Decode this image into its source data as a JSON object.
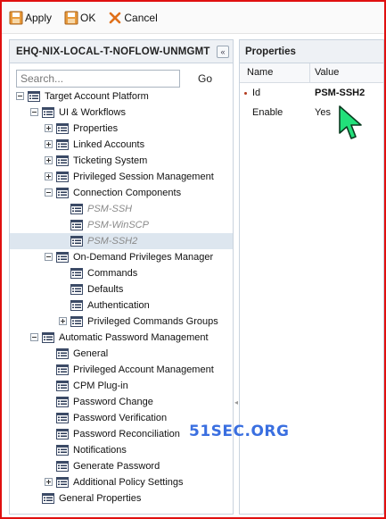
{
  "toolbar": {
    "apply_label": "Apply",
    "ok_label": "OK",
    "cancel_label": "Cancel"
  },
  "left_panel": {
    "title": "EHQ-NIX-LOCAL-T-NOFLOW-UNMGMT",
    "search_placeholder": "Search...",
    "go_label": "Go"
  },
  "tree": [
    {
      "label": "Target Account Platform",
      "level": 0,
      "ctrl": "minus",
      "greyed": false,
      "selected": false
    },
    {
      "label": "UI & Workflows",
      "level": 1,
      "ctrl": "minus",
      "greyed": false,
      "selected": false
    },
    {
      "label": "Properties",
      "level": 2,
      "ctrl": "plus",
      "greyed": false,
      "selected": false
    },
    {
      "label": "Linked Accounts",
      "level": 2,
      "ctrl": "plus",
      "greyed": false,
      "selected": false
    },
    {
      "label": "Ticketing System",
      "level": 2,
      "ctrl": "plus",
      "greyed": false,
      "selected": false
    },
    {
      "label": "Privileged Session Management",
      "level": 2,
      "ctrl": "plus",
      "greyed": false,
      "selected": false
    },
    {
      "label": "Connection Components",
      "level": 2,
      "ctrl": "minus",
      "greyed": false,
      "selected": false
    },
    {
      "label": "PSM-SSH",
      "level": 3,
      "ctrl": "none",
      "greyed": true,
      "selected": false
    },
    {
      "label": "PSM-WinSCP",
      "level": 3,
      "ctrl": "none",
      "greyed": true,
      "selected": false
    },
    {
      "label": "PSM-SSH2",
      "level": 3,
      "ctrl": "none",
      "greyed": true,
      "selected": true
    },
    {
      "label": "On-Demand Privileges Manager",
      "level": 2,
      "ctrl": "minus",
      "greyed": false,
      "selected": false
    },
    {
      "label": "Commands",
      "level": 3,
      "ctrl": "none",
      "greyed": false,
      "selected": false
    },
    {
      "label": "Defaults",
      "level": 3,
      "ctrl": "none",
      "greyed": false,
      "selected": false
    },
    {
      "label": "Authentication",
      "level": 3,
      "ctrl": "none",
      "greyed": false,
      "selected": false
    },
    {
      "label": "Privileged Commands Groups",
      "level": 3,
      "ctrl": "plus",
      "greyed": false,
      "selected": false
    },
    {
      "label": "Automatic Password Management",
      "level": 1,
      "ctrl": "minus",
      "greyed": false,
      "selected": false
    },
    {
      "label": "General",
      "level": 2,
      "ctrl": "none",
      "greyed": false,
      "selected": false
    },
    {
      "label": "Privileged Account Management",
      "level": 2,
      "ctrl": "none",
      "greyed": false,
      "selected": false
    },
    {
      "label": "CPM Plug-in",
      "level": 2,
      "ctrl": "none",
      "greyed": false,
      "selected": false
    },
    {
      "label": "Password Change",
      "level": 2,
      "ctrl": "none",
      "greyed": false,
      "selected": false
    },
    {
      "label": "Password Verification",
      "level": 2,
      "ctrl": "none",
      "greyed": false,
      "selected": false
    },
    {
      "label": "Password Reconciliation",
      "level": 2,
      "ctrl": "none",
      "greyed": false,
      "selected": false
    },
    {
      "label": "Notifications",
      "level": 2,
      "ctrl": "none",
      "greyed": false,
      "selected": false
    },
    {
      "label": "Generate Password",
      "level": 2,
      "ctrl": "none",
      "greyed": false,
      "selected": false
    },
    {
      "label": "Additional Policy Settings",
      "level": 2,
      "ctrl": "plus",
      "greyed": false,
      "selected": false
    },
    {
      "label": "General Properties",
      "level": 1,
      "ctrl": "none",
      "greyed": false,
      "selected": false
    }
  ],
  "right_panel": {
    "title": "Properties",
    "col_name": "Name",
    "col_value": "Value",
    "rows": [
      {
        "name": "Id",
        "value": "PSM-SSH2",
        "required": true
      },
      {
        "name": "Enable",
        "value": "Yes",
        "required": false
      }
    ]
  },
  "watermark": "51SEC.ORG",
  "colors": {
    "frame_border": "#e01010",
    "cursor_fill": "#22e07a",
    "watermark": "#3a6fe0",
    "selected_row": "#dde6ef"
  }
}
